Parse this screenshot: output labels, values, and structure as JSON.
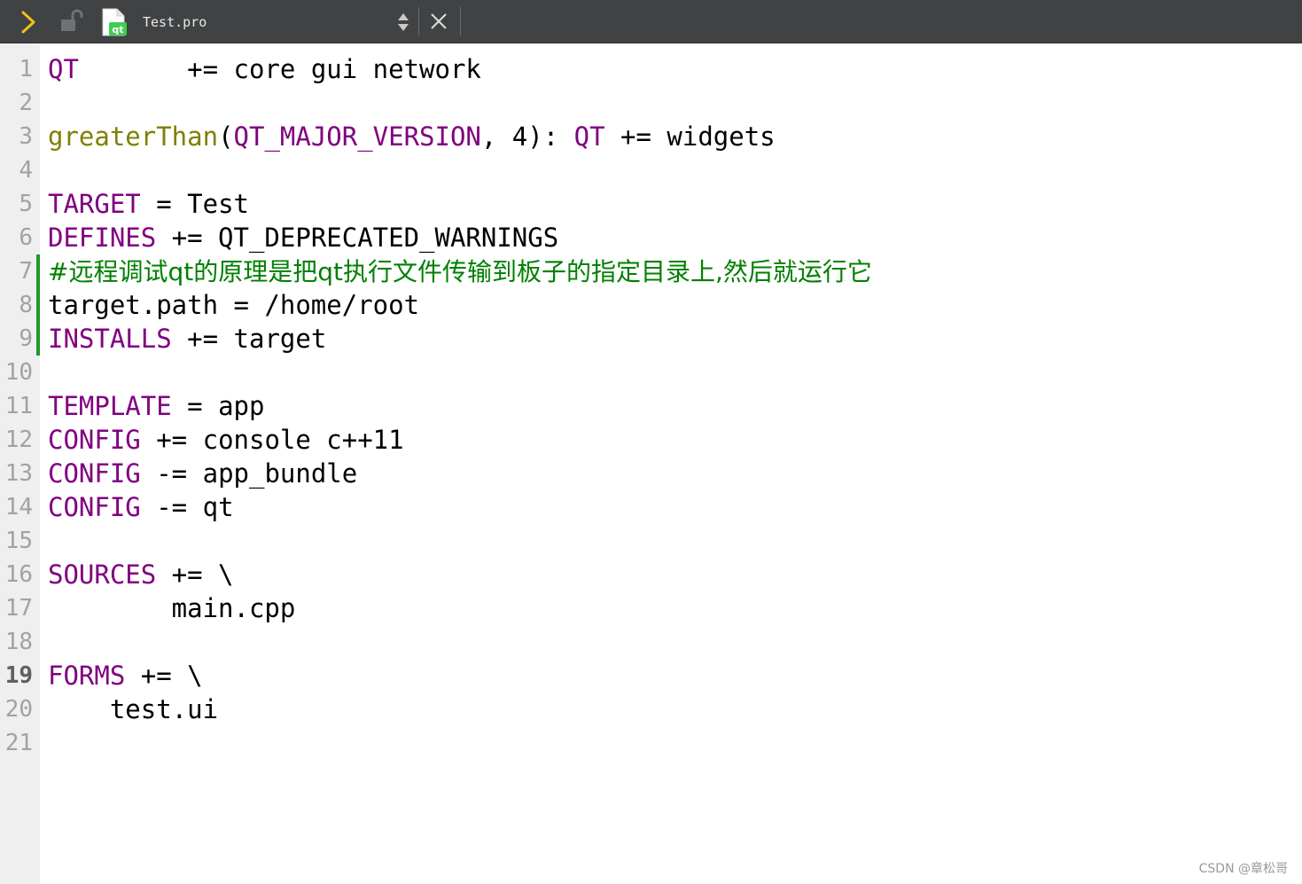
{
  "toolbar": {
    "filename": "Test.pro",
    "icons": {
      "nav": "chevron-right-icon",
      "lock": "lock-icon",
      "file": "qt-project-file-icon",
      "switcher": "up-down-arrows-icon",
      "close": "close-icon"
    }
  },
  "editor": {
    "current_line": 19,
    "changed_lines": [
      7,
      8,
      9
    ],
    "lines": [
      {
        "num": "1",
        "tokens": [
          {
            "t": "QT",
            "c": "kw"
          },
          {
            "t": "       += core gui network",
            "c": ""
          }
        ]
      },
      {
        "num": "2",
        "tokens": []
      },
      {
        "num": "3",
        "tokens": [
          {
            "t": "greaterThan",
            "c": "fn"
          },
          {
            "t": "(",
            "c": ""
          },
          {
            "t": "QT_MAJOR_VERSION",
            "c": "kw"
          },
          {
            "t": ", 4): ",
            "c": ""
          },
          {
            "t": "QT",
            "c": "kw"
          },
          {
            "t": " += widgets",
            "c": ""
          }
        ]
      },
      {
        "num": "4",
        "tokens": []
      },
      {
        "num": "5",
        "tokens": [
          {
            "t": "TARGET",
            "c": "kw"
          },
          {
            "t": " = Test",
            "c": ""
          }
        ]
      },
      {
        "num": "6",
        "tokens": [
          {
            "t": "DEFINES",
            "c": "kw"
          },
          {
            "t": " += QT_DEPRECATED_WARNINGS",
            "c": ""
          }
        ]
      },
      {
        "num": "7",
        "tokens": [
          {
            "t": "#远程调试qt的原理是把qt执行文件传输到板子的指定目录上,然后就运行它",
            "c": "cm"
          }
        ]
      },
      {
        "num": "8",
        "tokens": [
          {
            "t": "target.path = /home/root",
            "c": ""
          }
        ]
      },
      {
        "num": "9",
        "tokens": [
          {
            "t": "INSTALLS",
            "c": "kw"
          },
          {
            "t": " += target",
            "c": ""
          }
        ]
      },
      {
        "num": "10",
        "tokens": []
      },
      {
        "num": "11",
        "tokens": [
          {
            "t": "TEMPLATE",
            "c": "kw"
          },
          {
            "t": " = app",
            "c": ""
          }
        ]
      },
      {
        "num": "12",
        "tokens": [
          {
            "t": "CONFIG",
            "c": "kw"
          },
          {
            "t": " += console c++11",
            "c": ""
          }
        ]
      },
      {
        "num": "13",
        "tokens": [
          {
            "t": "CONFIG",
            "c": "kw"
          },
          {
            "t": " -= app_bundle",
            "c": ""
          }
        ]
      },
      {
        "num": "14",
        "tokens": [
          {
            "t": "CONFIG",
            "c": "kw"
          },
          {
            "t": " -= qt",
            "c": ""
          }
        ]
      },
      {
        "num": "15",
        "tokens": []
      },
      {
        "num": "16",
        "tokens": [
          {
            "t": "SOURCES",
            "c": "kw"
          },
          {
            "t": " += \\",
            "c": ""
          }
        ]
      },
      {
        "num": "17",
        "tokens": [
          {
            "t": "        main.cpp",
            "c": ""
          }
        ]
      },
      {
        "num": "18",
        "tokens": []
      },
      {
        "num": "19",
        "tokens": [
          {
            "t": "FORMS",
            "c": "kw"
          },
          {
            "t": " += \\",
            "c": ""
          }
        ]
      },
      {
        "num": "20",
        "tokens": [
          {
            "t": "    test.ui",
            "c": ""
          }
        ]
      },
      {
        "num": "21",
        "tokens": []
      }
    ]
  },
  "colors": {
    "toolbar_bg": "#404244",
    "gutter_bg": "#efefef",
    "keyword": "#800080",
    "function": "#808000",
    "comment": "#008000",
    "change_marker": "#1d9a2b",
    "nav_arrow": "#f0c020"
  },
  "watermark": "CSDN @章松哥"
}
